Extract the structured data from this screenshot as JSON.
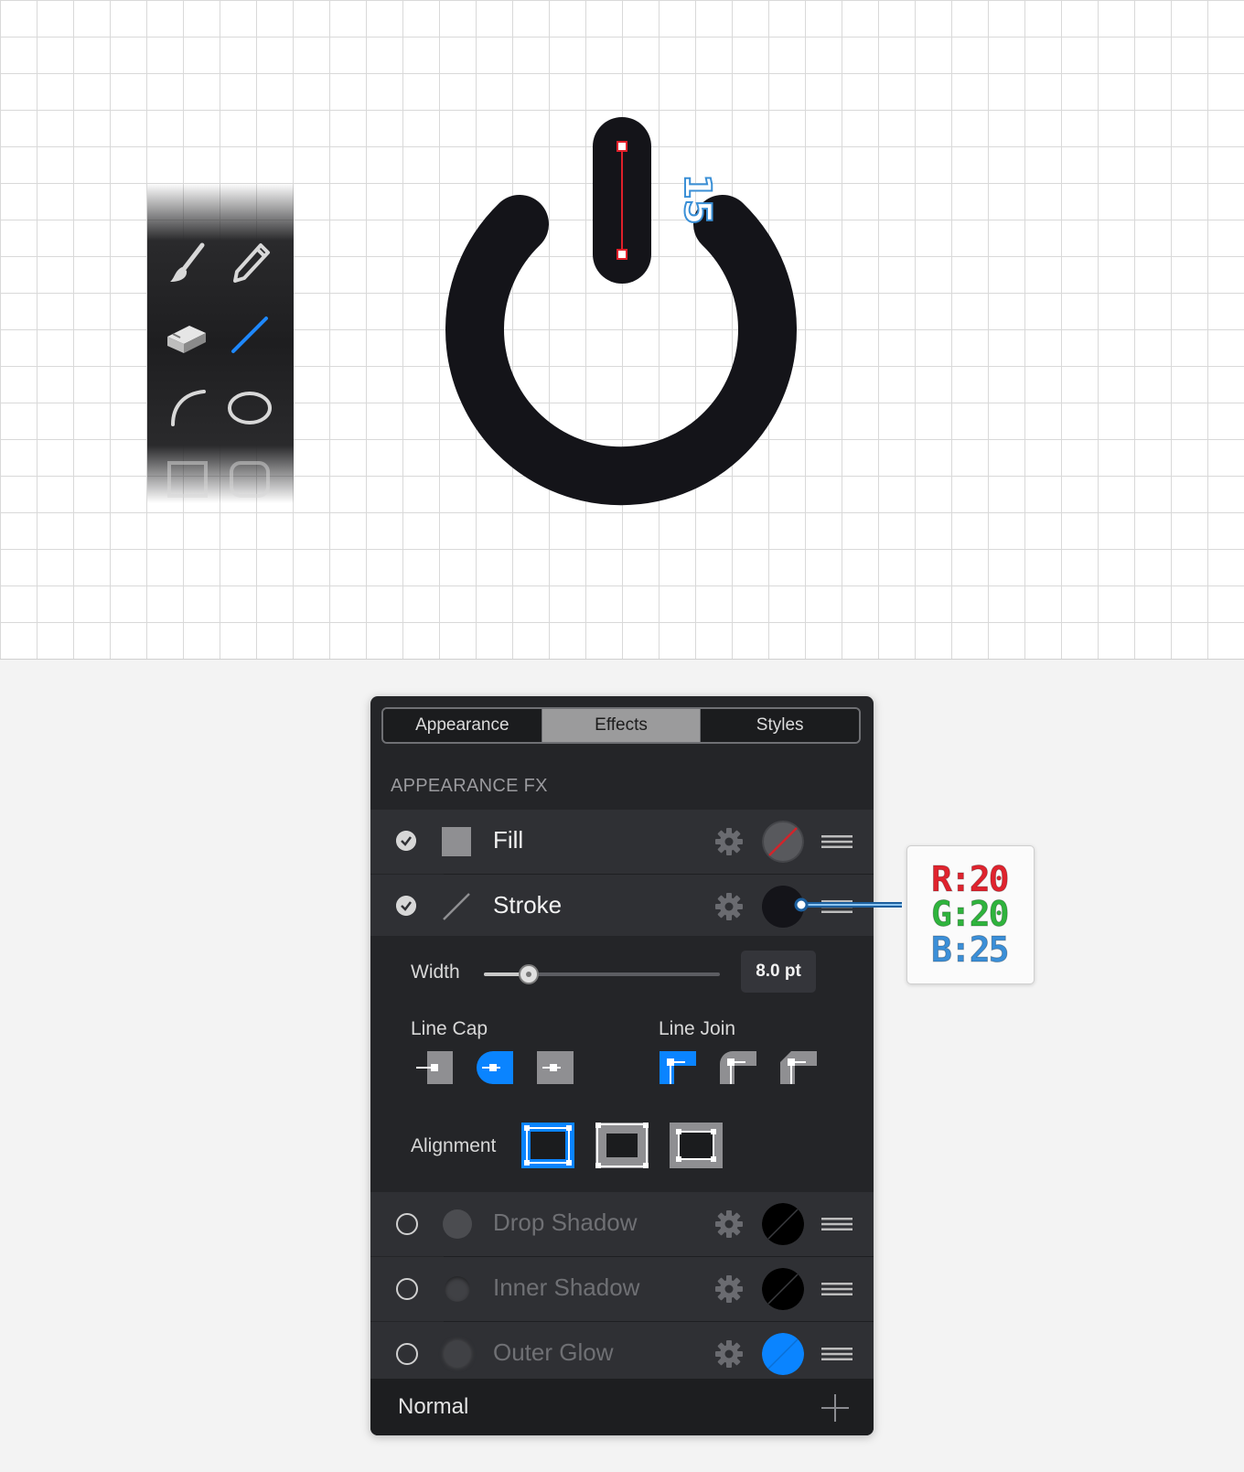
{
  "canvas": {
    "dimension_label": "15",
    "icon": "power-icon"
  },
  "toolbar": {
    "tools": [
      "paintbrush-icon",
      "pencil-icon",
      "eraser-icon",
      "line-icon",
      "arc-icon",
      "ellipse-icon",
      "rectangle-icon",
      "rounded-rectangle-icon"
    ],
    "active_tool": "line-icon"
  },
  "panel": {
    "tabs": [
      {
        "label": "Appearance",
        "active": false
      },
      {
        "label": "Effects",
        "active": true
      },
      {
        "label": "Styles",
        "active": false
      }
    ],
    "section_title": "APPEARANCE FX",
    "effects": {
      "fill": {
        "label": "Fill",
        "enabled": true
      },
      "stroke": {
        "label": "Stroke",
        "enabled": true,
        "color": "#141419"
      },
      "drop_shadow": {
        "label": "Drop Shadow",
        "enabled": false
      },
      "inner_shadow": {
        "label": "Inner Shadow",
        "enabled": false
      },
      "outer_glow": {
        "label": "Outer Glow",
        "enabled": false,
        "color": "#0a84ff"
      }
    },
    "stroke_options": {
      "width_label": "Width",
      "width_value": "8.0 pt",
      "width_slider_fraction": 0.19,
      "line_cap_label": "Line Cap",
      "line_cap_selected": "round",
      "line_join_label": "Line Join",
      "line_join_selected": "miter",
      "alignment_label": "Alignment",
      "alignment_selected": "center"
    },
    "blend_mode": "Normal"
  },
  "callout": {
    "r": "R:20",
    "g": "G:20",
    "b": "B:25"
  },
  "colors": {
    "accent": "#0a84ff",
    "icon_color": "#141419"
  }
}
